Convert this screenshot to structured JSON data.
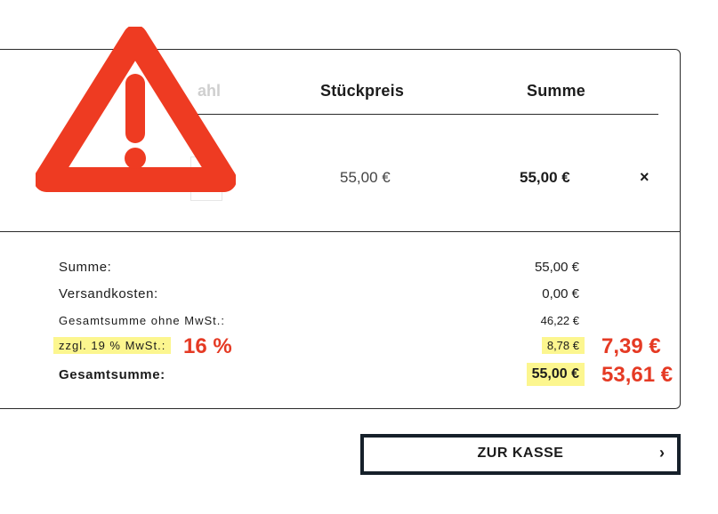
{
  "table_header": {
    "faded_label": "ahl",
    "unit_price": "Stückpreis",
    "sum": "Summe"
  },
  "item": {
    "unit_price": "55,00 €",
    "total": "55,00 €",
    "remove_label": "×"
  },
  "summary": {
    "rows": [
      {
        "label": "Summe:",
        "value": "55,00 €"
      },
      {
        "label": "Versandkosten:",
        "value": "0,00 €"
      },
      {
        "label": "Gesamtsumme ohne MwSt.:",
        "value": "46,22 €"
      },
      {
        "label": "zzgl. 19 % MwSt.:",
        "value": "8,78 €"
      },
      {
        "label": "Gesamtsumme:",
        "value": "55,00 €"
      }
    ]
  },
  "annotations": {
    "vat_rate_correct": "16 %",
    "vat_amount_correct": "7,39 €",
    "total_correct": "53,61 €",
    "highlight_color": "#fcf68f",
    "note_color": "#e53a24"
  },
  "warning": {
    "icon": "warning-triangle-icon",
    "color": "#ee3b22"
  },
  "checkout": {
    "label": "ZUR KASSE",
    "chevron": "›"
  }
}
